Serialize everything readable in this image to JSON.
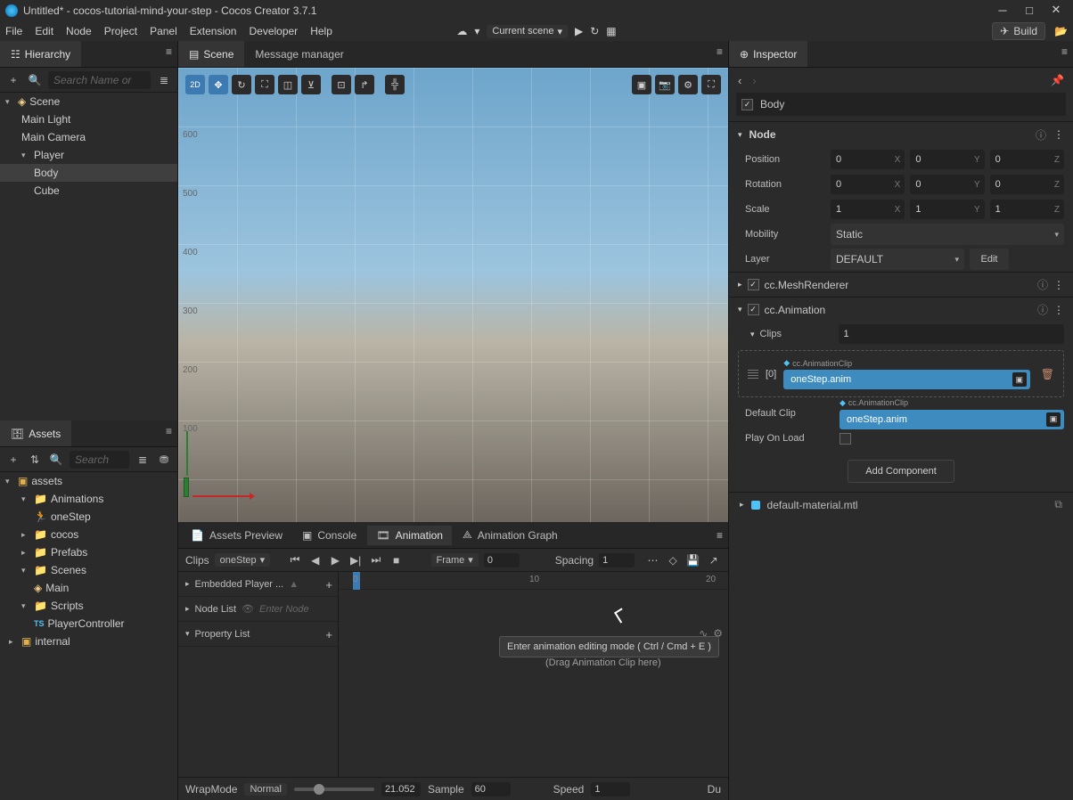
{
  "title": "Untitled* - cocos-tutorial-mind-your-step - Cocos Creator 3.7.1",
  "menubar": {
    "items": [
      "File",
      "Edit",
      "Node",
      "Project",
      "Panel",
      "Extension",
      "Developer",
      "Help"
    ],
    "scene_dd": "Current scene",
    "build": "Build"
  },
  "hierarchy": {
    "title": "Hierarchy",
    "search_placeholder": "Search Name or",
    "items": [
      "Scene",
      "Main Light",
      "Main Camera",
      "Player",
      "Body",
      "Cube"
    ]
  },
  "assets": {
    "title": "Assets",
    "search_placeholder": "Search",
    "tree": [
      "assets",
      "Animations",
      "oneStep",
      "cocos",
      "Prefabs",
      "Scenes",
      "Main",
      "Scripts",
      "PlayerController",
      "internal"
    ]
  },
  "center_tabs": {
    "items": [
      "Scene",
      "Message manager"
    ]
  },
  "anim_tabs": {
    "items": [
      "Assets Preview",
      "Console",
      "Animation",
      "Animation Graph"
    ]
  },
  "anim_toolbar": {
    "clips": "Clips",
    "clipname": "oneStep",
    "frame_label": "Frame",
    "frame_val": "0",
    "spacing_label": "Spacing",
    "spacing_val": "1"
  },
  "anim_sections": {
    "embedded": "Embedded Player ...",
    "nodelist": "Node List",
    "enternode": "Enter Node",
    "proplist": "Property List",
    "tooltip": "Enter animation editing mode ( Ctrl / Cmd + E )",
    "drag": "(Drag Animation Clip here)"
  },
  "anim_timeline": {
    "t0": "0",
    "t10": "10",
    "t20": "20"
  },
  "anim_footer": {
    "wrap": "WrapMode",
    "wrapval": "Normal",
    "timeval": "21.052",
    "sample": "Sample",
    "sampleval": "60",
    "speed": "Speed",
    "speedval": "1",
    "du": "Du"
  },
  "inspector": {
    "title": "Inspector",
    "name": "Body",
    "node": "Node",
    "pos": "Position",
    "rot": "Rotation",
    "scale": "Scale",
    "mobility": "Mobility",
    "mobility_val": "Static",
    "layer": "Layer",
    "layer_val": "DEFAULT",
    "edit": "Edit",
    "pos_vals": [
      "0",
      "0",
      "0"
    ],
    "rot_vals": [
      "0",
      "0",
      "0"
    ],
    "scale_vals": [
      "1",
      "1",
      "1"
    ],
    "mesh": "cc.MeshRenderer",
    "anim": "cc.Animation",
    "clips_label": "Clips",
    "clips_count": "1",
    "clip_idx": "[0]",
    "clip_tag": "cc.AnimationClip",
    "clip_val": "oneStep.anim",
    "defclip": "Default Clip",
    "playonload": "Play On Load",
    "addcomp": "Add Component",
    "material": "default-material.mtl"
  }
}
